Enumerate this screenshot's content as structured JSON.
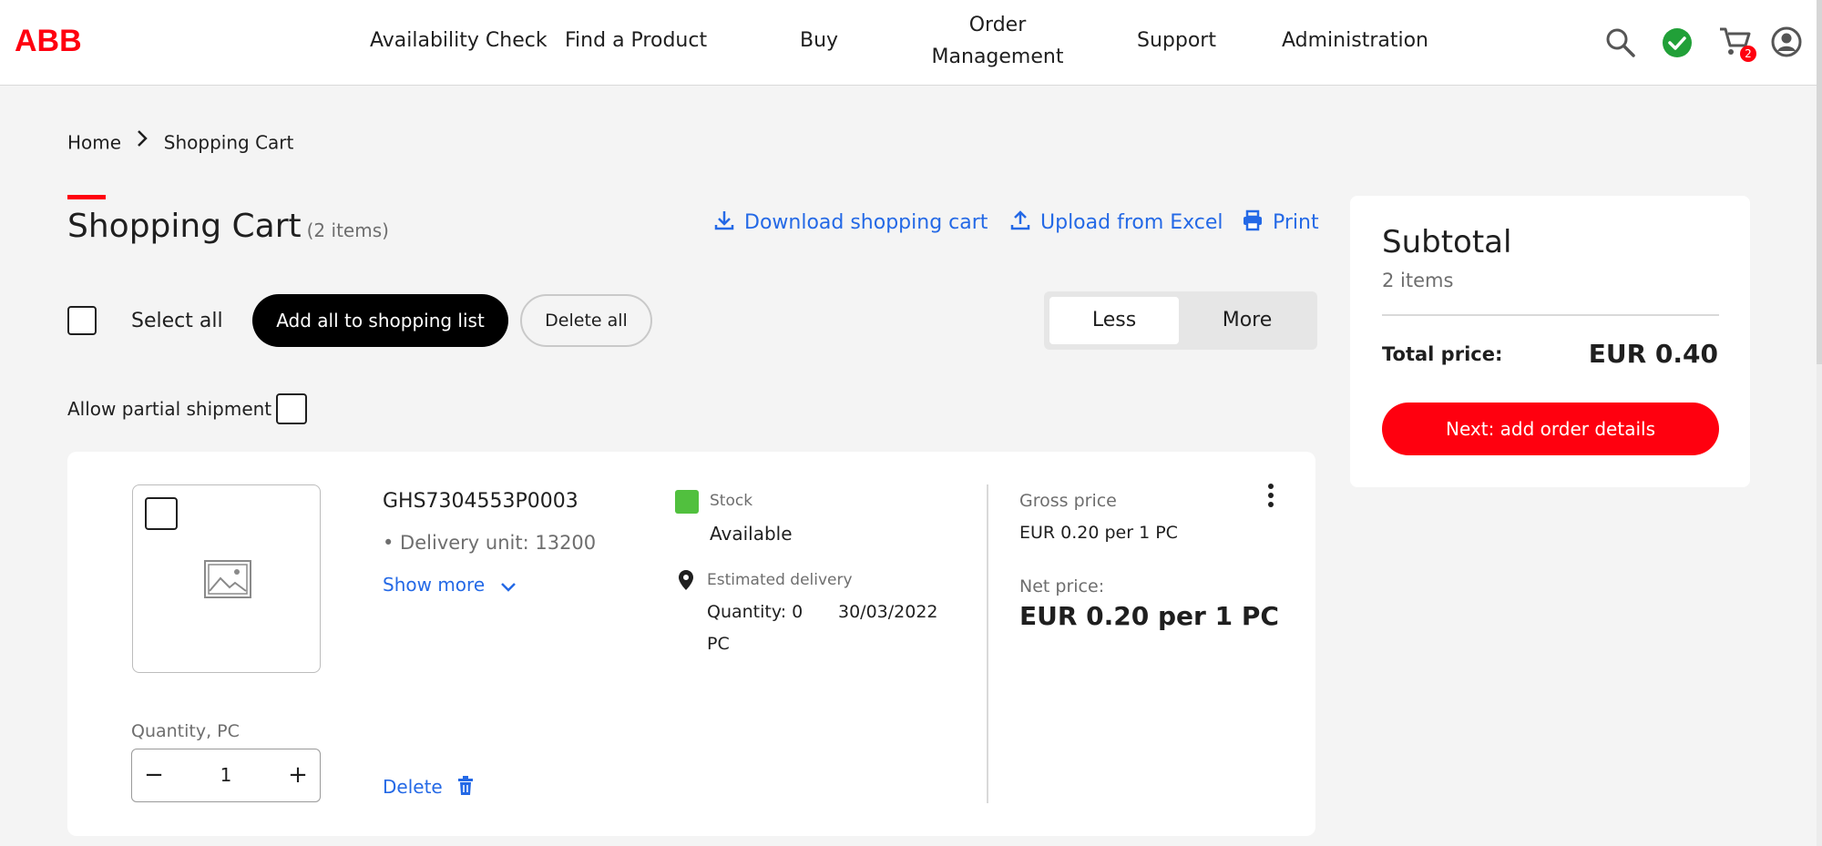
{
  "brand": {
    "logo_text": "ABB",
    "accent_color": "#ff000f",
    "link_color": "#2469e6"
  },
  "nav": {
    "items": [
      {
        "label": "Availability Check"
      },
      {
        "label": "Find a Product"
      },
      {
        "label": "Buy"
      },
      {
        "label": "Order Management"
      },
      {
        "label": "Support"
      },
      {
        "label": "Administration"
      }
    ],
    "icons": [
      "search-icon",
      "status-check-icon",
      "cart-icon",
      "account-icon"
    ],
    "cart_badge": "2"
  },
  "breadcrumb": {
    "home": "Home",
    "current": "Shopping Cart"
  },
  "page": {
    "title": "Shopping Cart",
    "item_count": "(2 items)"
  },
  "actions": {
    "download": "Download shopping cart",
    "upload": "Upload from Excel",
    "print": "Print"
  },
  "toolbar": {
    "select_all": "Select all",
    "add_all": "Add all to shopping list",
    "delete_all": "Delete all",
    "view_less": "Less",
    "view_more": "More",
    "view_selected": "Less"
  },
  "partial_shipment": {
    "label": "Allow partial shipment",
    "checked": false
  },
  "cart_item": {
    "sku": "GHS7304553P0003",
    "delivery_unit": "• Delivery unit: 13200",
    "show_more": "Show more",
    "stock_label": "Stock",
    "stock_value": "Available",
    "stock_color": "#51c03e",
    "est_delivery_label": "Estimated delivery",
    "est_quantity_line1": "Quantity: 0",
    "est_quantity_line2": "PC",
    "est_date": "30/03/2022",
    "gross_label": "Gross price",
    "gross_value": "EUR 0.20 per 1 PC",
    "net_label": "Net price",
    "net_value": "EUR 0.20 per 1 PC",
    "quantity_label": "Quantity, PC",
    "quantity": "1",
    "decrement": "−",
    "increment": "+",
    "delete": "Delete"
  },
  "summary": {
    "title": "Subtotal",
    "items": "2 items",
    "total_label": "Total price:",
    "total_value": "EUR 0.40",
    "next_button": "Next: add order details"
  }
}
